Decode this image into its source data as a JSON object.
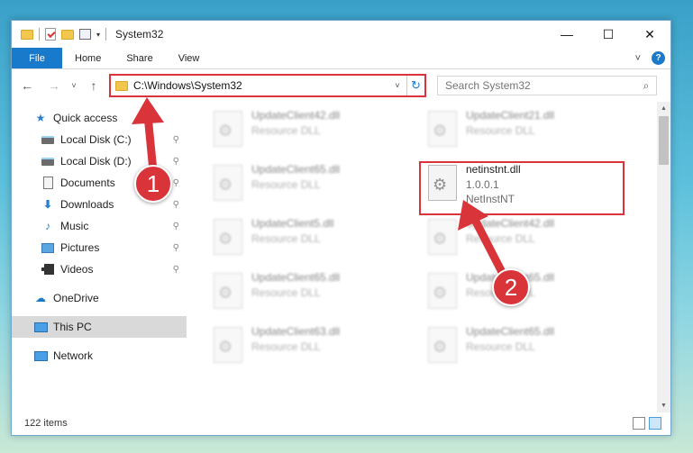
{
  "window": {
    "title": "System32",
    "controls": {
      "minimize": "—",
      "maximize": "☐",
      "close": "✕"
    }
  },
  "ribbon": {
    "tabs": [
      "File",
      "Home",
      "Share",
      "View"
    ],
    "expand": "˅",
    "help": "?"
  },
  "nav": {
    "back": "←",
    "forward": "→",
    "recent": "˅",
    "up": "↑",
    "address": "C:\\Windows\\System32",
    "address_caret": "˅",
    "refresh": "↻",
    "search_placeholder": "Search System32",
    "search_glyph": "⌕"
  },
  "sidebar": {
    "quick_access": "Quick access",
    "pinned": [
      {
        "label": "Local Disk (C:)",
        "icon": "disk-icon"
      },
      {
        "label": "Local Disk (D:)",
        "icon": "disk-icon"
      },
      {
        "label": "Documents",
        "icon": "documents-icon"
      },
      {
        "label": "Downloads",
        "icon": "downloads-icon"
      },
      {
        "label": "Music",
        "icon": "music-icon"
      },
      {
        "label": "Pictures",
        "icon": "pictures-icon"
      },
      {
        "label": "Videos",
        "icon": "videos-icon"
      }
    ],
    "pin_glyph": "⚲",
    "onedrive": "OneDrive",
    "this_pc": "This PC",
    "network": "Network"
  },
  "files": [
    {
      "name": "UpdateClient42.dll",
      "sub": "Resource DLL",
      "blurred": true
    },
    {
      "name": "UpdateClient21.dll",
      "sub": "Resource DLL",
      "blurred": true
    },
    {
      "name": "UpdateClient65.dll",
      "sub": "Resource DLL",
      "blurred": true
    },
    {
      "name": "netinstnt.dll",
      "version": "1.0.0.1",
      "sub": "NetInstNT",
      "blurred": false
    },
    {
      "name": "UpdateClient5.dll",
      "sub": "Resource DLL",
      "blurred": true
    },
    {
      "name": "UpdateClient42.dll",
      "sub": "Resource DLL",
      "blurred": true
    },
    {
      "name": "UpdateClient65.dll",
      "sub": "Resource DLL",
      "blurred": true
    },
    {
      "name": "UpdateClient65.dll",
      "sub": "Resource DLL",
      "blurred": true
    },
    {
      "name": "UpdateClient63.dll",
      "sub": "Resource DLL",
      "blurred": true
    },
    {
      "name": "UpdateClient65.dll",
      "sub": "Resource DLL",
      "blurred": true
    }
  ],
  "status": {
    "items": "122 items"
  },
  "annotations": {
    "step1": "1",
    "step2": "2",
    "color": "#d9343a"
  }
}
